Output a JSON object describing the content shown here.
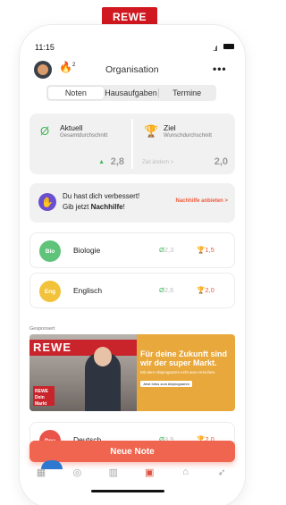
{
  "brand_badge": "REWE",
  "status": {
    "time": "11:15",
    "signal": "..ıl"
  },
  "header": {
    "title": "Organisation",
    "fire_count": "2",
    "more": "•••"
  },
  "segmented": {
    "options": [
      "Noten",
      "Hausaufgaben",
      "Termine"
    ],
    "selected": "Noten"
  },
  "stats": {
    "current": {
      "label": "Aktuell",
      "sub": "Gesamtdurchschnitt",
      "value": "2,8",
      "trend": "▲"
    },
    "goal": {
      "label": "Ziel",
      "sub": "Wunschdurchschnitt",
      "value": "2,0",
      "link": "Ziel ändern >"
    }
  },
  "promo": {
    "line1": "Du hast dich verbessert!",
    "line2_prefix": "Gib jetzt ",
    "line2_bold": "Nachhilfe",
    "line2_suffix": "!",
    "cta": "Nachhilfe anbieten >"
  },
  "subjects": [
    {
      "badge": "Bio",
      "name": "Biologie",
      "avg": "2,3",
      "goal": "1,5",
      "color": "#5fc37a"
    },
    {
      "badge": "Eng",
      "name": "Englisch",
      "avg": "2,6",
      "goal": "2,0",
      "color": "#f2c23b"
    },
    {
      "badge": "Deu",
      "name": "Deutsch",
      "avg": "3,9",
      "goal": "2,0",
      "color": "#e9534a"
    }
  ],
  "sponsored_label": "Gesponsert",
  "ad": {
    "brand": "REWE",
    "logo": "REWE Dein Markt",
    "headline": "Für deine Zukunft sind wir der super Markt.",
    "small": "Mit dem Abiprogramm echt was erreichen.",
    "button": "Jetzt Infos zum Abiprogramm"
  },
  "fab_label": "Neue Note",
  "tabs": [
    {
      "name": "grid",
      "glyph": "▦"
    },
    {
      "name": "coin",
      "glyph": "◎"
    },
    {
      "name": "calendar",
      "glyph": "▥"
    },
    {
      "name": "grades",
      "glyph": "▣"
    },
    {
      "name": "school",
      "glyph": "⌂"
    },
    {
      "name": "rocket",
      "glyph": "➶"
    }
  ],
  "colors": {
    "accent": "#f0654f",
    "green": "#46b85c",
    "gold": "#e6a817",
    "rewe_red": "#c9242b"
  }
}
